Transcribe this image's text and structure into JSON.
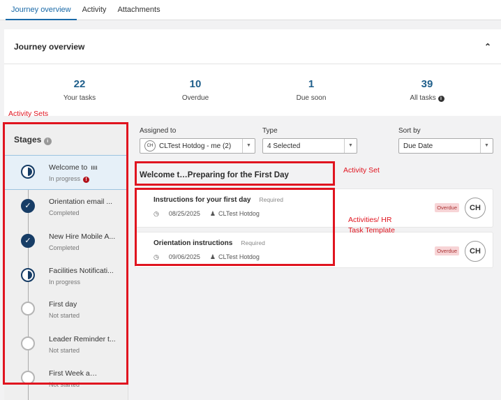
{
  "tabs": [
    "Journey overview",
    "Activity",
    "Attachments"
  ],
  "overview": {
    "title": "Journey overview",
    "collapse_icon": "chevron-up-icon",
    "stats": [
      {
        "value": "22",
        "label": "Your tasks"
      },
      {
        "value": "10",
        "label": "Overdue"
      },
      {
        "value": "1",
        "label": "Due soon"
      },
      {
        "value": "39",
        "label": "All tasks"
      }
    ]
  },
  "stages": {
    "title": "Stages",
    "items": [
      {
        "name": "Welcome to  ιιιι",
        "status": "In progress",
        "state": "progress",
        "alert": "!"
      },
      {
        "name": "Orientation email ...",
        "status": "Completed",
        "state": "done"
      },
      {
        "name": "New Hire Mobile A...",
        "status": "Completed",
        "state": "done"
      },
      {
        "name": "Facilities Notificati...",
        "status": "In progress",
        "state": "progress"
      },
      {
        "name": "First day",
        "status": "Not started",
        "state": "none"
      },
      {
        "name": "Leader Reminder t...",
        "status": "Not started",
        "state": "none"
      },
      {
        "name": "First Week a…",
        "status": "Not started",
        "state": "none"
      }
    ]
  },
  "filters": {
    "assigned_label": "Assigned to",
    "assigned_value": "CLTest Hotdog - me (2)",
    "assigned_avatar": "CH",
    "type_label": "Type",
    "type_value": "4 Selected",
    "sort_label": "Sort by",
    "sort_value": "Due Date"
  },
  "activity_set_title": "Welcome t…Preparing for the First Day",
  "tasks": [
    {
      "name": "Instructions for your first day",
      "required": "Required",
      "date": "08/25/2025",
      "assignee": "CLTest Hotdog",
      "badge": "Overdue",
      "avatar": "CH"
    },
    {
      "name": "Orientation instructions",
      "required": "Required",
      "date": "09/06/2025",
      "assignee": "CLTest Hotdog",
      "badge": "Overdue",
      "avatar": "CH"
    }
  ],
  "annotations": {
    "activity_sets": "Activity Sets",
    "activity_set": "Activity Set",
    "activities": "Activities/ HR",
    "activities2": "Task Template"
  },
  "colors": {
    "accent": "#1a6aa8",
    "annotation": "#e0141f",
    "stage_dark": "#173d66"
  }
}
